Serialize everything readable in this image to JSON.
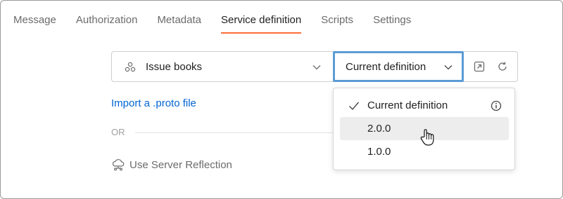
{
  "tabs": [
    {
      "label": "Message",
      "active": false
    },
    {
      "label": "Authorization",
      "active": false
    },
    {
      "label": "Metadata",
      "active": false
    },
    {
      "label": "Service definition",
      "active": true
    },
    {
      "label": "Scripts",
      "active": false
    },
    {
      "label": "Settings",
      "active": false
    }
  ],
  "service": {
    "label": "Issue books",
    "icon": "service-nodes-icon"
  },
  "definition": {
    "selected": "Current definition",
    "options": [
      {
        "label": "Current definition",
        "checked": true,
        "info": true
      },
      {
        "label": "2.0.0",
        "hovered": true
      },
      {
        "label": "1.0.0"
      }
    ]
  },
  "actions": {
    "open_icon": "open-external-icon",
    "refresh_icon": "refresh-icon"
  },
  "import_link": "Import a .proto file",
  "or_text": "OR",
  "reflection": {
    "label": "Use Server Reflection",
    "icon": "cloud-network-icon"
  },
  "colors": {
    "active_tab_underline": "#ff6c37",
    "link": "#0265d2",
    "focus_border": "#5b9bd5",
    "hover_bg": "#ededed"
  }
}
